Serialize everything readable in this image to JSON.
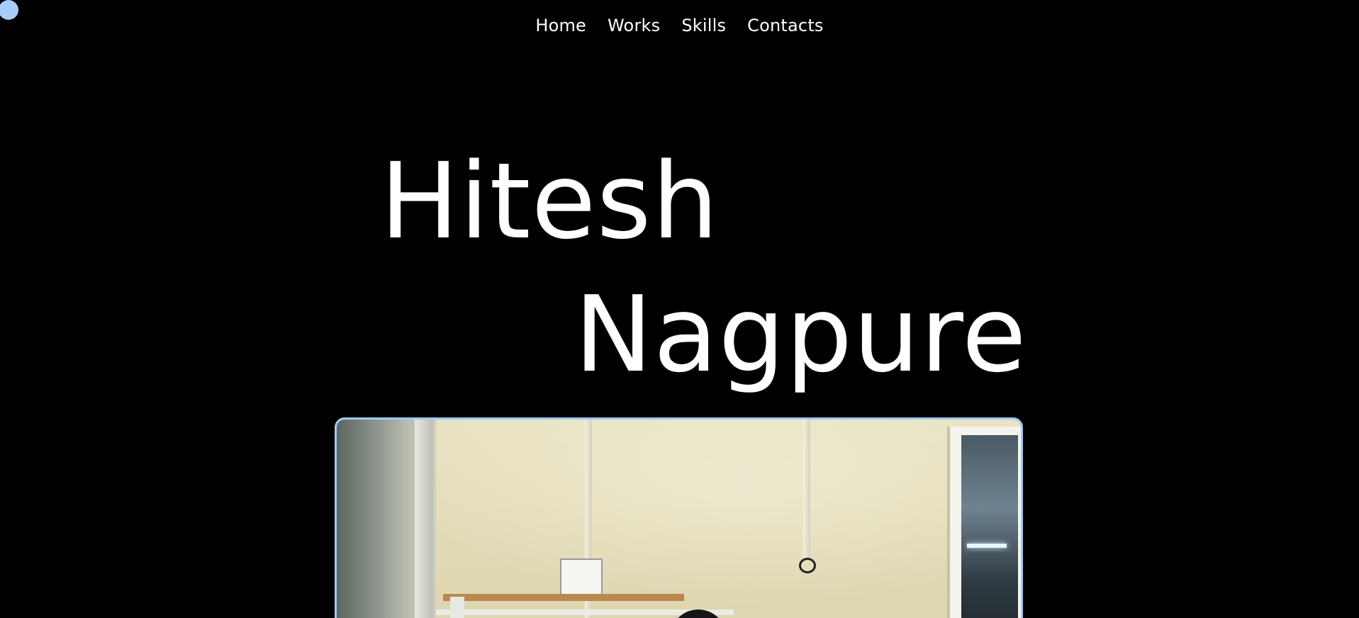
{
  "nav": {
    "items": [
      {
        "label": "Home"
      },
      {
        "label": "Works"
      },
      {
        "label": "Skills"
      },
      {
        "label": "Contacts"
      }
    ]
  },
  "hero": {
    "first_name": "Hitesh",
    "last_name": "Nagpure"
  },
  "media": {
    "border_color": "#9ecbf5"
  },
  "colors": {
    "background": "#000000",
    "text": "#ffffff",
    "accent": "#a9cdfb"
  }
}
